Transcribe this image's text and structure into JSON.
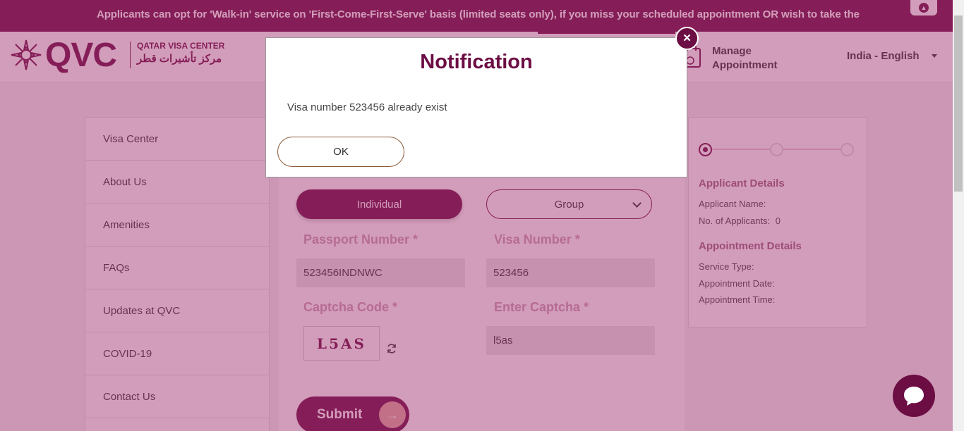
{
  "banner": {
    "text": "Applicants can opt for 'Walk-in' service on 'First-Come-First-Serve' basis (limited seats only), if you miss your scheduled appointment OR wish to take the",
    "scroll_top_icon": "chevron-up-icon"
  },
  "header": {
    "logo_text": "QVC",
    "logo_en": "QATAR VISA CENTER",
    "logo_ar": "مركز تأشيرات قطر",
    "manage_line1": "Manage",
    "manage_line2": "Appointment",
    "language": "India - English"
  },
  "sidebar": {
    "items": [
      {
        "label": "Visa Center"
      },
      {
        "label": "About Us"
      },
      {
        "label": "Amenities"
      },
      {
        "label": "FAQs"
      },
      {
        "label": "Updates at QVC"
      },
      {
        "label": "COVID-19"
      },
      {
        "label": "Contact Us"
      }
    ]
  },
  "form": {
    "tab_individual": "Individual",
    "tab_group": "Group",
    "passport_label": "Passport Number *",
    "passport_value": "523456INDNWC",
    "visa_label": "Visa Number *",
    "visa_value": "523456",
    "captcha_label": "Captcha Code *",
    "captcha_image_text": "L5AS",
    "enter_captcha_label": "Enter Captcha *",
    "enter_captcha_value": "l5as",
    "submit_label": "Submit"
  },
  "summary": {
    "applicant_details_heading": "Applicant Details",
    "applicant_name_label": "Applicant Name:",
    "num_applicants_label": "No. of Applicants:",
    "num_applicants_value": "0",
    "appointment_details_heading": "Appointment Details",
    "service_type_label": "Service Type:",
    "appointment_date_label": "Appointment Date:",
    "appointment_time_label": "Appointment Time:"
  },
  "modal": {
    "title": "Notification",
    "message": "Visa number 523456 already exist",
    "ok_label": "OK",
    "close_label": "×"
  },
  "colors": {
    "brand": "#6c0d44",
    "overlay": "#a0326e"
  }
}
